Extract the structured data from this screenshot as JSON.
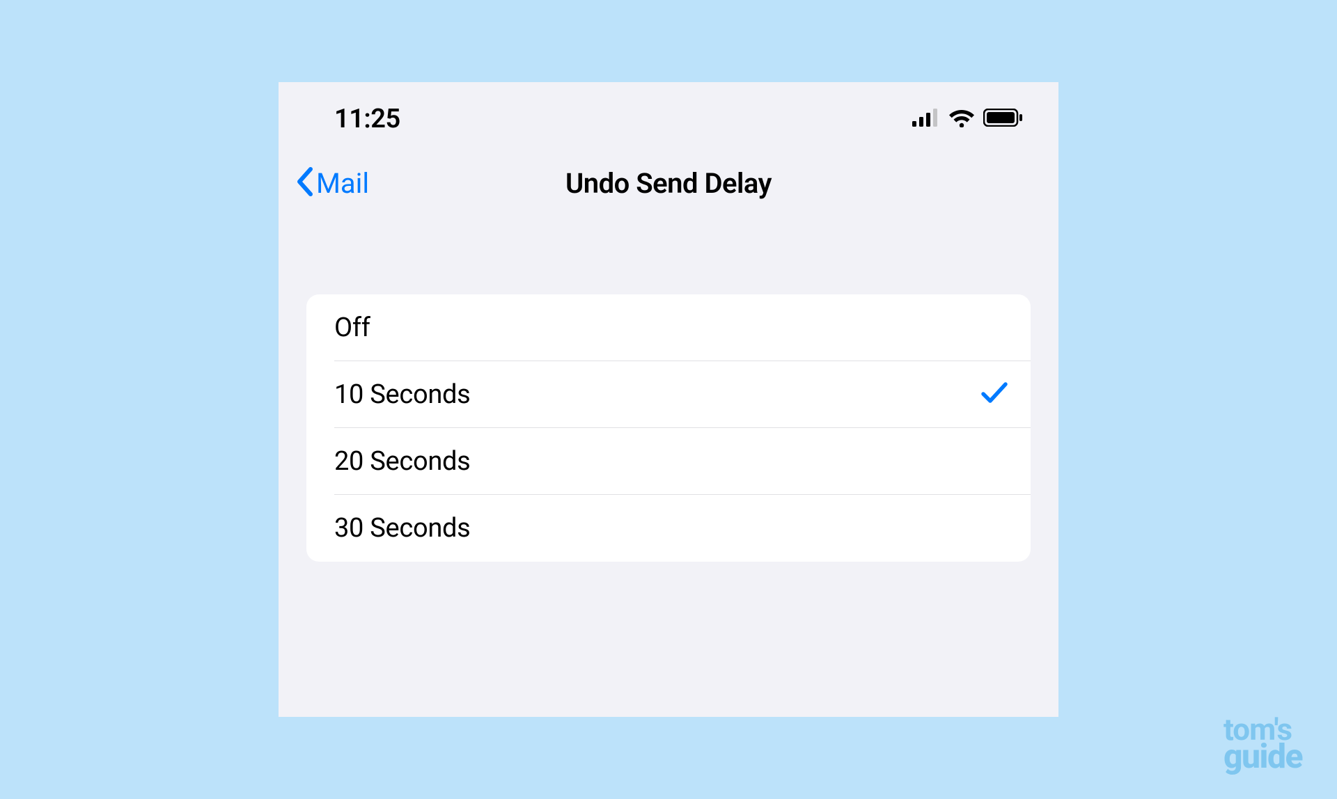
{
  "statusBar": {
    "time": "11:25"
  },
  "navBar": {
    "backLabel": "Mail",
    "title": "Undo Send Delay"
  },
  "options": [
    {
      "label": "Off",
      "selected": false
    },
    {
      "label": "10 Seconds",
      "selected": true
    },
    {
      "label": "20 Seconds",
      "selected": false
    },
    {
      "label": "30 Seconds",
      "selected": false
    }
  ],
  "watermark": {
    "line1": "tom's",
    "line2": "guide"
  }
}
